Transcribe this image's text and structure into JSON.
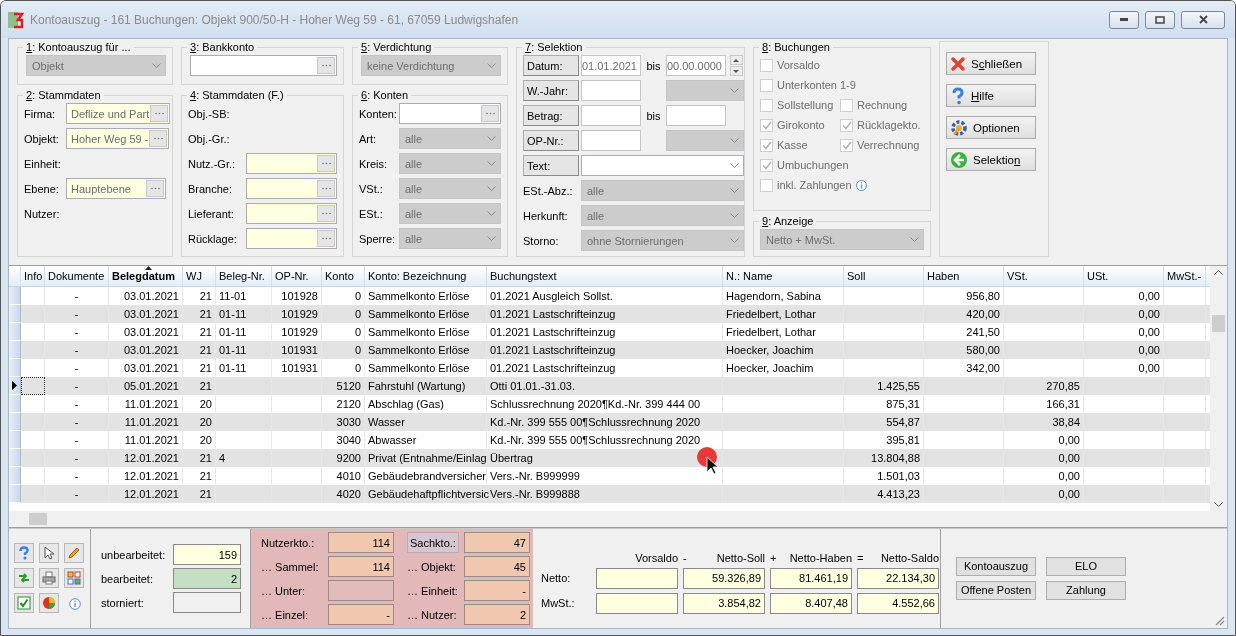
{
  "window": {
    "title": "Kontoauszug - 161 Buchungen: Objekt 900/50-H - Hoher Weg 59 - 61, 67059 Ludwigshafen"
  },
  "groups": [
    {
      "title": "1: Kontoauszug für ...",
      "rows": [
        {
          "fields": [
            {
              "kind": "combo",
              "value": "Objekt",
              "disabled": true
            }
          ]
        }
      ]
    },
    {
      "title": "2: Stammdaten",
      "rows": [
        {
          "label": "Firma:",
          "fields": [
            {
              "kind": "lookup",
              "value": "Deflize und Part",
              "readonly": true
            }
          ]
        },
        {
          "label": "Objekt:",
          "fields": [
            {
              "kind": "lookup",
              "value": "Hoher Weg 59 -",
              "readonly": true
            }
          ]
        },
        {
          "label": "Einheit:"
        },
        {
          "label": "Ebene:",
          "fields": [
            {
              "kind": "lookup",
              "value": "Hauptebene",
              "readonly": true
            }
          ]
        },
        {
          "label": "Nutzer:"
        }
      ]
    },
    {
      "title": "3: Bankkonto",
      "rows": [
        {
          "fields": [
            {
              "kind": "lookup",
              "readonly": false
            }
          ]
        }
      ]
    },
    {
      "title": "4: Stammdaten (F.)",
      "rows": [
        {
          "label": "Obj.-SB:"
        },
        {
          "label": "Obj.-Gr.:"
        },
        {
          "label": "Nutz.-Gr.:",
          "fields": [
            {
              "kind": "lookup",
              "readonly": true
            }
          ]
        },
        {
          "label": "Branche:",
          "fields": [
            {
              "kind": "lookup",
              "readonly": true
            }
          ]
        },
        {
          "label": "Lieferant:",
          "fields": [
            {
              "kind": "lookup",
              "readonly": true
            }
          ]
        },
        {
          "label": "Rücklage:",
          "fields": [
            {
              "kind": "lookup",
              "readonly": true
            }
          ]
        }
      ]
    },
    {
      "title": "5: Verdichtung",
      "rows": [
        {
          "fields": [
            {
              "kind": "combo",
              "value": "keine Verdichtung",
              "disabled": true
            }
          ]
        }
      ]
    },
    {
      "title": "6: Konten",
      "rows": [
        {
          "label": "Konten:",
          "fields": [
            {
              "kind": "lookup",
              "readonly": false
            }
          ]
        },
        {
          "label": "Art:",
          "fields": [
            {
              "kind": "combo",
              "value": "alle",
              "disabled": true
            }
          ]
        },
        {
          "label": "Kreis:",
          "fields": [
            {
              "kind": "combo",
              "value": "alle",
              "disabled": true
            }
          ]
        },
        {
          "label": "VSt.:",
          "fields": [
            {
              "kind": "combo",
              "value": "alle",
              "disabled": true
            }
          ]
        },
        {
          "label": "ESt.:",
          "fields": [
            {
              "kind": "combo",
              "value": "alle",
              "disabled": true
            }
          ]
        },
        {
          "label": "Sperre:",
          "fields": [
            {
              "kind": "combo",
              "value": "alle",
              "disabled": true
            }
          ]
        }
      ]
    }
  ],
  "selektion": {
    "title": "7: Selektion",
    "rows": [
      {
        "label": "Datum:",
        "kind": "button",
        "fields": [
          {
            "kind": "input",
            "value": "01.01.2021"
          },
          {
            "kind": "word",
            "text": "bis"
          },
          {
            "kind": "input",
            "value": "00.00.0000"
          },
          {
            "kind": "spinner"
          }
        ]
      },
      {
        "label": "W.-Jahr:",
        "kind": "button",
        "fields": [
          {
            "kind": "input"
          },
          {
            "kind": "combo",
            "disabled": true
          }
        ]
      },
      {
        "label": "Betrag:",
        "kind": "button",
        "fields": [
          {
            "kind": "input"
          },
          {
            "kind": "word",
            "text": "bis"
          },
          {
            "kind": "input"
          }
        ]
      },
      {
        "label": "OP-Nr.:",
        "kind": "button",
        "fields": [
          {
            "kind": "input"
          },
          {
            "kind": "combo",
            "disabled": true
          }
        ]
      },
      {
        "label": "Text:",
        "kind": "button",
        "fields": [
          {
            "kind": "combo",
            "disabled": false
          }
        ]
      },
      {
        "label": "ESt.-Abz.:",
        "kind": "plain",
        "fields": [
          {
            "kind": "combo",
            "value": "alle",
            "disabled": true
          }
        ]
      },
      {
        "label": "Herkunft:",
        "kind": "plain",
        "fields": [
          {
            "kind": "combo",
            "value": "alle",
            "disabled": true
          }
        ]
      },
      {
        "label": "Storno:",
        "kind": "plain",
        "fields": [
          {
            "kind": "combo",
            "value": "ohne Stornierungen",
            "disabled": true
          }
        ]
      }
    ]
  },
  "buchungen": {
    "title": "8: Buchungen",
    "rows": [
      [
        {
          "label": "Vorsaldo",
          "checked": false,
          "disabled": true
        }
      ],
      [
        {
          "label": "Unterkonten 1-9",
          "checked": false,
          "disabled": true
        }
      ],
      [
        {
          "label": "Sollstellung",
          "checked": false,
          "disabled": true
        },
        {
          "label": "Rechnung",
          "checked": false,
          "disabled": true
        }
      ],
      [
        {
          "label": "Girokonto",
          "checked": true,
          "disabled": true
        },
        {
          "label": "Rücklagekto.",
          "checked": true,
          "disabled": true
        }
      ],
      [
        {
          "label": "Kasse",
          "checked": true,
          "disabled": true
        },
        {
          "label": "Verrechnung",
          "checked": true,
          "disabled": true
        }
      ],
      [
        {
          "label": "Umbuchungen",
          "checked": true,
          "disabled": true
        }
      ],
      [
        {
          "label": "inkl. Zahlungen",
          "checked": false,
          "disabled": true,
          "info": true
        }
      ]
    ]
  },
  "anzeige": {
    "title": "9: Anzeige",
    "value": "Netto + MwSt.",
    "disabled": true
  },
  "actions": [
    {
      "label": "Schließen",
      "kind": "close"
    },
    {
      "label": "Hilfe",
      "kind": "help"
    },
    {
      "label": "Optionen",
      "kind": "options"
    },
    {
      "label": "Selektion",
      "kind": "back"
    }
  ],
  "table": {
    "columns": [
      {
        "label": "Info",
        "sorted": false
      },
      {
        "label": "Dokumente",
        "sorted": false
      },
      {
        "label": "Belegdatum",
        "sorted": true
      },
      {
        "label": "WJ",
        "sorted": false
      },
      {
        "label": "Beleg-Nr.",
        "sorted": false
      },
      {
        "label": "OP-Nr.",
        "sorted": false
      },
      {
        "label": "Konto",
        "sorted": false
      },
      {
        "label": "Konto: Bezeichnung",
        "sorted": false
      },
      {
        "label": "Buchungstext",
        "sorted": false
      },
      {
        "label": "N.: Name",
        "sorted": false
      },
      {
        "label": "Soll",
        "sorted": false
      },
      {
        "label": "Haben",
        "sorted": false
      },
      {
        "label": "VSt.",
        "sorted": false
      },
      {
        "label": "USt.",
        "sorted": false
      },
      {
        "label": "MwSt.-",
        "sorted": false
      }
    ],
    "rows": [
      {
        "current": false,
        "cells": [
          null,
          "-",
          "03.01.2021",
          "21",
          "11-01",
          "101928",
          "0",
          "Sammelkonto Erlöse",
          "01.2021 Ausgleich Sollst.",
          "Hagendorn, Sabina",
          null,
          "956,80",
          null,
          "0,00",
          null
        ]
      },
      {
        "current": false,
        "cells": [
          null,
          "-",
          "03.01.2021",
          "21",
          "01-11",
          "101929",
          "0",
          "Sammelkonto Erlöse",
          "01.2021 Lastschrifteinzug",
          "Friedelbert, Lothar",
          null,
          "420,00",
          null,
          "0,00",
          null
        ]
      },
      {
        "current": false,
        "cells": [
          null,
          "-",
          "03.01.2021",
          "21",
          "01-11",
          "101929",
          "0",
          "Sammelkonto Erlöse",
          "01.2021 Lastschrifteinzug",
          "Friedelbert, Lothar",
          null,
          "241,50",
          null,
          "0,00",
          null
        ]
      },
      {
        "current": false,
        "cells": [
          null,
          "-",
          "03.01.2021",
          "21",
          "01-11",
          "101931",
          "0",
          "Sammelkonto Erlöse",
          "01.2021 Lastschrifteinzug",
          "Hoecker, Joachim",
          null,
          "580,00",
          null,
          "0,00",
          null
        ]
      },
      {
        "current": false,
        "cells": [
          null,
          "-",
          "03.01.2021",
          "21",
          "01-11",
          "101931",
          "0",
          "Sammelkonto Erlöse",
          "01.2021 Lastschrifteinzug",
          "Hoecker, Joachim",
          null,
          "342,00",
          null,
          "0,00",
          null
        ]
      },
      {
        "current": true,
        "cells": [
          null,
          "-",
          "05.01.2021",
          "21",
          null,
          null,
          "5120",
          "Fahrstuhl (Wartung)",
          "Otti 01.01.-31.03.",
          null,
          "1.425,55",
          null,
          "270,85",
          null,
          null
        ]
      },
      {
        "current": false,
        "cells": [
          null,
          "-",
          "11.01.2021",
          "20",
          null,
          null,
          "2120",
          "Abschlag (Gas)",
          "Schlussrechnung 2020¶Kd.-Nr. 399 444 00",
          null,
          "875,31",
          null,
          "166,31",
          null,
          null
        ]
      },
      {
        "current": false,
        "cells": [
          null,
          "-",
          "11.01.2021",
          "20",
          null,
          null,
          "3030",
          "Wasser",
          "Kd.-Nr. 399 555 00¶Schlussrechnung 2020",
          null,
          "554,87",
          null,
          "38,84",
          null,
          null
        ]
      },
      {
        "current": false,
        "cells": [
          null,
          "-",
          "11.01.2021",
          "20",
          null,
          null,
          "3040",
          "Abwasser",
          "Kd.-Nr. 399 555 00¶Schlussrechnung 2020",
          null,
          "395,81",
          null,
          "0,00",
          null,
          null
        ]
      },
      {
        "current": false,
        "cells": [
          null,
          "-",
          "12.01.2021",
          "21",
          "4",
          null,
          "9200",
          "Privat (Entnahme/Einlag",
          "Übertrag",
          null,
          "13.804,88",
          null,
          "0,00",
          null,
          null
        ]
      },
      {
        "current": false,
        "cells": [
          null,
          "-",
          "12.01.2021",
          "21",
          null,
          null,
          "4010",
          "Gebäudebrandversicher",
          "Vers.-Nr. B999999",
          null,
          "1.501,03",
          null,
          "0,00",
          null,
          null
        ]
      },
      {
        "current": false,
        "cells": [
          null,
          "-",
          "12.01.2021",
          "21",
          null,
          null,
          "4020",
          "Gebäudehaftpflichtversic",
          "Vers.-Nr. B999888",
          null,
          "4.413,23",
          null,
          "0,00",
          null,
          null
        ]
      }
    ]
  },
  "counters": [
    {
      "label": "unbearbeitet:",
      "value": "159",
      "color": "#ffffe1"
    },
    {
      "label": "bearbeitet:",
      "value": "2",
      "color": "#c4dfc4"
    },
    {
      "label": "storniert:",
      "color": "#f0f0f0"
    }
  ],
  "account_counts": [
    {
      "label": "Nutzerkto.:",
      "value": "114",
      "highlighted": false,
      "disabled": false
    },
    {
      "label": "Sachkto.:",
      "value": "47",
      "highlighted": true,
      "disabled": false
    },
    {
      "label": "… Sammel:",
      "value": "114",
      "highlighted": false,
      "disabled": false
    },
    {
      "label": "… Objekt:",
      "value": "45",
      "highlighted": false,
      "disabled": false
    },
    {
      "label": "… Unter:",
      "highlighted": false,
      "disabled": true
    },
    {
      "label": "… Einheit:",
      "value": "-",
      "highlighted": false,
      "disabled": false
    },
    {
      "label": "… Einzel:",
      "value": "-",
      "highlighted": false,
      "disabled": false
    },
    {
      "label": "… Nutzer:",
      "value": "2",
      "highlighted": false,
      "disabled": false
    }
  ],
  "totals": {
    "headers": [
      {
        "label": "Vorsaldo"
      },
      {
        "operator": "-",
        "label": "Netto-Soll"
      },
      {
        "operator": "+",
        "label": "Netto-Haben"
      },
      {
        "operator": "=",
        "label": "Netto-Saldo"
      }
    ],
    "rows": [
      {
        "label": "Netto:",
        "values": [
          "59.326,89",
          "81.461,19",
          "22.134,30"
        ]
      },
      {
        "label": "MwSt.:",
        "values": [
          "3.854,82",
          "8.407,48",
          "4.552,66"
        ]
      }
    ]
  },
  "report_buttons": [
    "Kontoauszug",
    "ELO",
    "Offene Posten",
    "Zahlung"
  ]
}
